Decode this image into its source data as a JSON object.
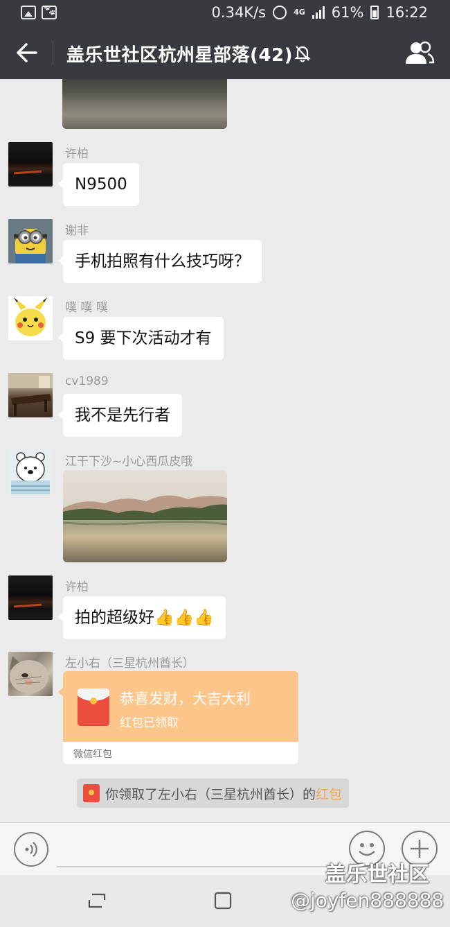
{
  "status_bar": {
    "net_speed": "0.34K/s",
    "network": "4G",
    "battery": "61%",
    "time": "16:22"
  },
  "header": {
    "title": "盖乐世社区杭州星部落(42)"
  },
  "messages": [
    {
      "sender": "许柏",
      "text": "N9500"
    },
    {
      "sender": "谢非",
      "text": "手机拍照有什么技巧呀？"
    },
    {
      "sender": "噗 噗 噗",
      "text": "S9 要下次活动才有"
    },
    {
      "sender": "cv1989",
      "text": "我不是先行者"
    },
    {
      "sender": "江干下沙~小心西瓜皮哦"
    },
    {
      "sender": "许柏",
      "text": "拍的超级好👍👍👍"
    },
    {
      "sender": "左小右（三星杭州酋长）"
    }
  ],
  "red_packet": {
    "title": "恭喜发财，大吉大利",
    "status": "红包已领取",
    "footer": "微信红包"
  },
  "notice": {
    "text": "你领取了左小右（三星杭州酋长）的",
    "link": "红包"
  },
  "watermark": {
    "line1": "盖乐世社区",
    "line2": "@joyfen888888"
  },
  "colors": {
    "title_bar": "#393a3f",
    "chat_bg": "#ebebeb",
    "red_packet": "#fcc58a",
    "link": "#f5a64a"
  }
}
